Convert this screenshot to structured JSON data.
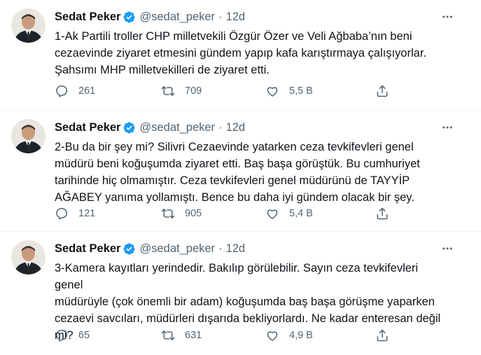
{
  "colors": {
    "text": "#0f1419",
    "secondary": "#536471",
    "verified": "#1d9bf0",
    "divider": "#eff3f4"
  },
  "icons": {
    "verified": "verified-badge-icon",
    "more": "more-options-icon",
    "reply": "reply-icon",
    "retweet": "retweet-icon",
    "like": "like-icon",
    "share": "share-icon"
  },
  "tweets": [
    {
      "name": "Sedat Peker",
      "handle": "@sedat_peker",
      "separator": "·",
      "time": "12d",
      "text": "1-Ak Partili troller CHP milletvekili Özgür Özer ve Veli Ağbaba’nın beni\ncezaevinde ziyaret etmesini gündem yapıp kafa karıştırmaya çalışıyorlar.\nŞahsımı MHP milletvekilleri de ziyaret etti.",
      "replies": "261",
      "retweets": "709",
      "likes": "5,5 B"
    },
    {
      "name": "Sedat Peker",
      "handle": "@sedat_peker",
      "separator": "·",
      "time": "12d",
      "text": "2-Bu da bir şey mi? Silivri Cezaevinde yatarken ceza tevkifevleri genel\nmüdürü beni koğuşumda ziyaret etti. Baş başa görüştük. Bu cumhuriyet\ntarihinde hiç olmamıştır. Ceza tevkifevleri genel müdürünü de TAYYİP\nAĞABEY yanıma yollamıştı. Bence bu daha iyi gündem olacak bir şey.",
      "replies": "121",
      "retweets": "905",
      "likes": "5,4 B"
    },
    {
      "name": "Sedat Peker",
      "handle": "@sedat_peker",
      "separator": "·",
      "time": "12d",
      "text": "3-Kamera kayıtları yerindedir. Bakılıp görülebilir. Sayın ceza tevkifevleri genel\nmüdürüyle (çok önemli bir adam) koğuşumda baş başa görüşme yaparken\ncezaevi savcıları, müdürleri dışarıda bekliyorlardı. Ne kadar enteresan değil\nmi?",
      "replies": "65",
      "retweets": "631",
      "likes": "4,9 B"
    }
  ]
}
